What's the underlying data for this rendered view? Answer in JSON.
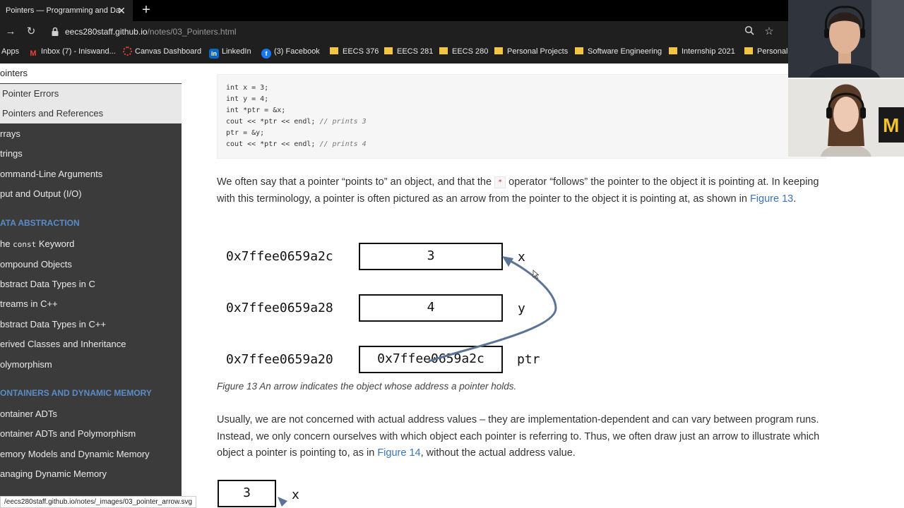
{
  "browser": {
    "tab_title": "Pointers — Programming and Da",
    "url_host": "eecs280staff.github.io",
    "url_path": "/notes/03_Pointers.html",
    "bookmarks": [
      {
        "label": "Apps",
        "icon": "apps-icon"
      },
      {
        "label": "Inbox (7) - Iniswand...",
        "icon": "gmail-icon"
      },
      {
        "label": "Canvas Dashboard",
        "icon": "canvas-icon"
      },
      {
        "label": "LinkedIn",
        "icon": "linkedin-icon"
      },
      {
        "label": "(3) Facebook",
        "icon": "facebook-icon"
      },
      {
        "label": "EECS 376",
        "icon": "folder-icon"
      },
      {
        "label": "EECS 281",
        "icon": "folder-icon"
      },
      {
        "label": "EECS 280",
        "icon": "folder-icon"
      },
      {
        "label": "Personal Projects",
        "icon": "folder-icon"
      },
      {
        "label": "Software Engineering",
        "icon": "folder-icon"
      },
      {
        "label": "Internship 2021",
        "icon": "folder-icon"
      },
      {
        "label": "Personal",
        "icon": "folder-icon"
      }
    ],
    "status_url": "/eecs280staff.github.io/notes/_images/03_pointer_arrow.svg"
  },
  "sidebar": {
    "current": "ointers",
    "subitems": [
      "Pointer Errors",
      "Pointers and References"
    ],
    "items_a": [
      "rrays",
      "trings",
      "ommand-Line Arguments",
      "put and Output (I/O)"
    ],
    "heading_1": "ATA ABSTRACTION",
    "const_prefix": "he ",
    "const_code": "const",
    "const_suffix": " Keyword",
    "items_b": [
      "ompound Objects",
      "bstract Data Types in C",
      "treams in C++",
      "bstract Data Types in C++",
      "erived Classes and Inheritance",
      "olymorphism"
    ],
    "heading_2": "ONTAINERS AND DYNAMIC MEMORY",
    "items_c": [
      "ontainer ADTs",
      "ontainer ADTs and Polymorphism",
      "emory Models and Dynamic Memory",
      "anaging Dynamic Memory"
    ]
  },
  "content": {
    "code_lines": [
      {
        "code": "int x = 3;",
        "comment": ""
      },
      {
        "code": "int y = 4;",
        "comment": ""
      },
      {
        "code": "int *ptr = &x;",
        "comment": ""
      },
      {
        "code": "cout << *ptr << endl; ",
        "comment": "// prints 3"
      },
      {
        "code": "ptr = &y;",
        "comment": ""
      },
      {
        "code": "cout << *ptr << endl; ",
        "comment": "// prints 4"
      }
    ],
    "para1_a": "We often say that a pointer “points to” an object, and that the ",
    "para1_op": "*",
    "para1_b": " operator “follows” the pointer to the object it is pointing at. In keeping with this terminology, a pointer is often pictured as an arrow from the pointer to the object it is pointing at, as shown in ",
    "para1_link": "Figure 13",
    "para1_end": ".",
    "figure13": {
      "rows": [
        {
          "address": "0x7ffee0659a2c",
          "value": "3",
          "name": "x"
        },
        {
          "address": "0x7ffee0659a28",
          "value": "4",
          "name": "y"
        },
        {
          "address": "0x7ffee0659a20",
          "value": "0x7ffee0659a2c",
          "name": "ptr"
        }
      ],
      "arrow_color": "#5b7397"
    },
    "caption_label": "Figure 13",
    "caption_text": " An arrow indicates the object whose address a pointer holds.",
    "para2_a": "Usually, we are not concerned with actual address values – they are implementation-dependent and can vary between program runs. Instead, we only concern ourselves with which object each pointer is referring to. Thus, we often draw just an arrow to illustrate which object a pointer is pointing to, as in ",
    "para2_link": "Figure 14",
    "para2_b": ", without the actual address value.",
    "figure14": {
      "value": "3",
      "name": "x"
    }
  }
}
